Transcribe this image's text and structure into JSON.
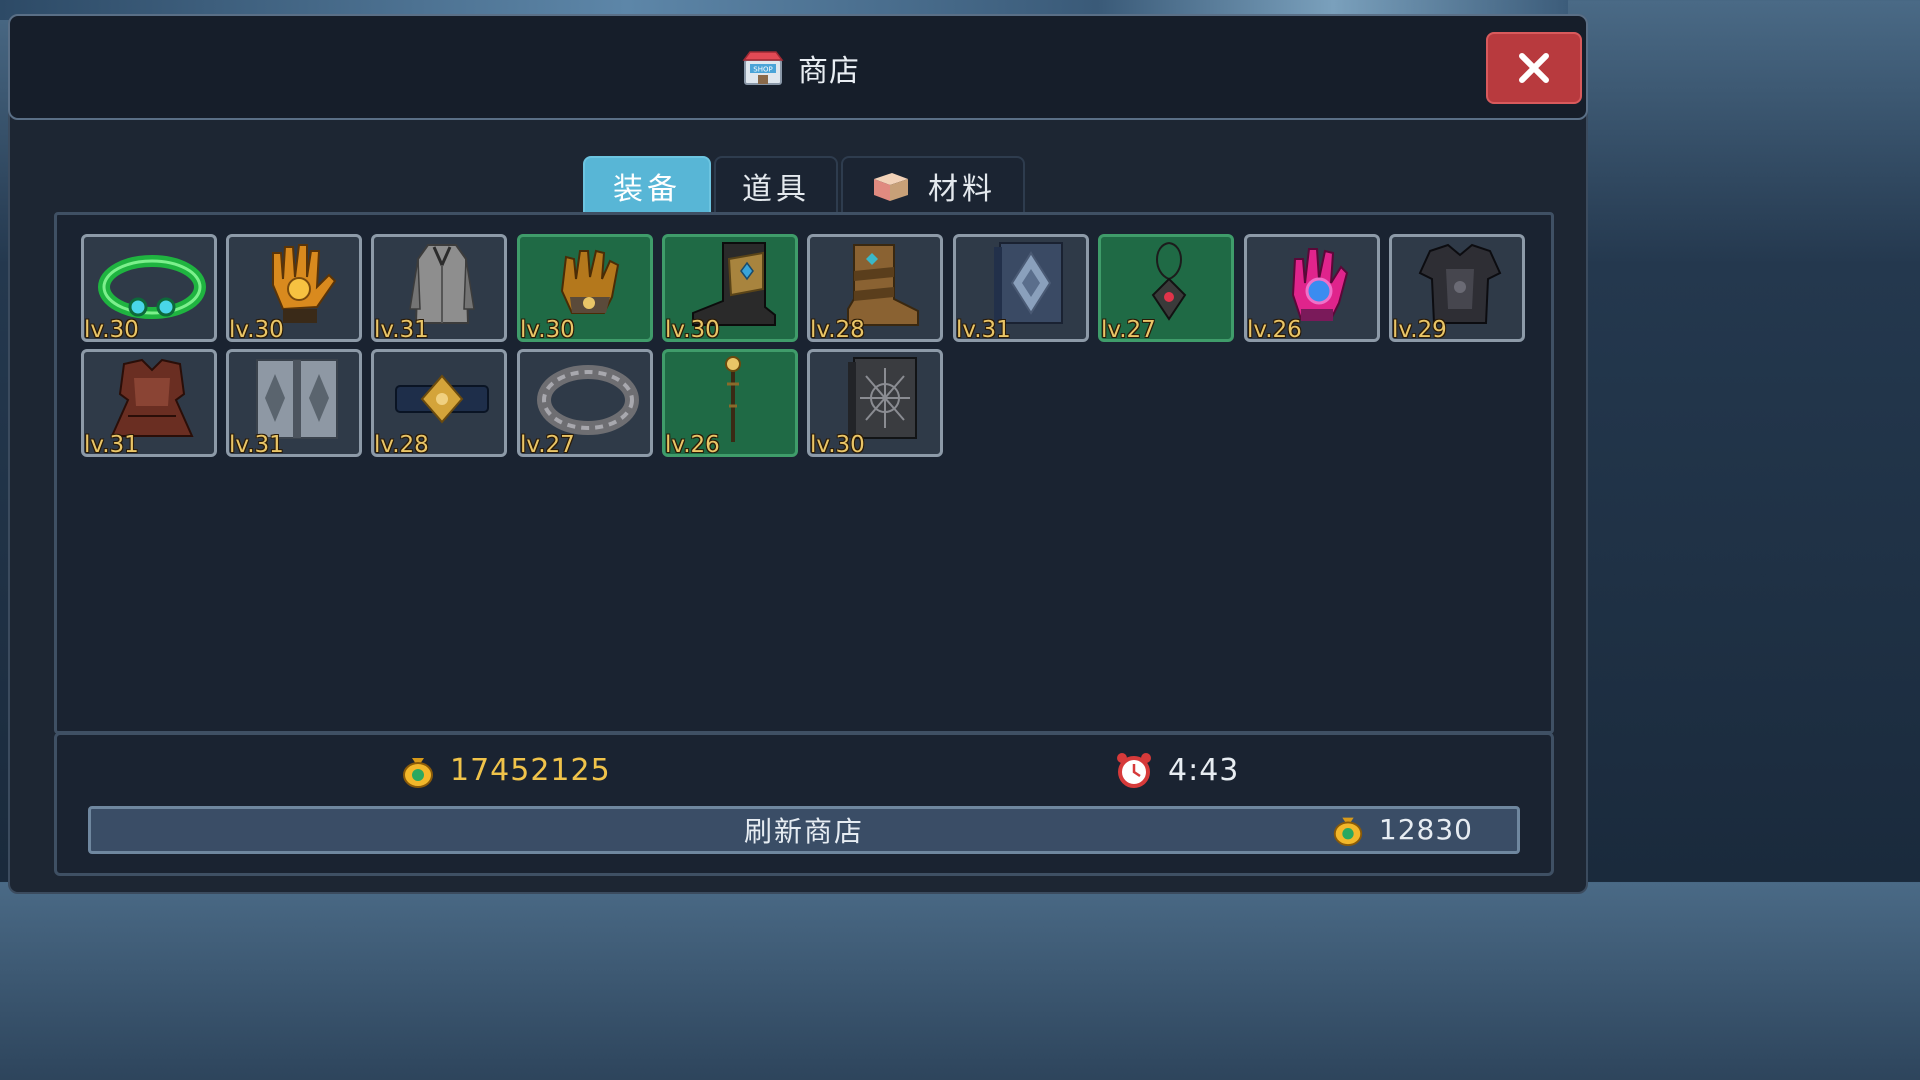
{
  "title": "商店",
  "tabs": [
    {
      "label": "装备",
      "active": true
    },
    {
      "label": "道具",
      "active": false
    },
    {
      "label": "材料",
      "active": false,
      "icon": "box-icon"
    }
  ],
  "items": [
    {
      "level": "lv.30",
      "icon": "ring-icon",
      "rarity": "normal"
    },
    {
      "level": "lv.30",
      "icon": "gauntlet-icon",
      "rarity": "normal"
    },
    {
      "level": "lv.31",
      "icon": "robe-icon",
      "rarity": "normal"
    },
    {
      "level": "lv.30",
      "icon": "gauntlet-icon",
      "rarity": "rare"
    },
    {
      "level": "lv.30",
      "icon": "boot-icon",
      "rarity": "rare"
    },
    {
      "level": "lv.28",
      "icon": "boot-icon",
      "rarity": "normal"
    },
    {
      "level": "lv.31",
      "icon": "tome-icon",
      "rarity": "normal"
    },
    {
      "level": "lv.27",
      "icon": "amulet-icon",
      "rarity": "rare"
    },
    {
      "level": "lv.26",
      "icon": "gauntlet-icon",
      "rarity": "normal"
    },
    {
      "level": "lv.29",
      "icon": "chest-armor-icon",
      "rarity": "normal"
    },
    {
      "level": "lv.31",
      "icon": "leather-armor-icon",
      "rarity": "normal"
    },
    {
      "level": "lv.31",
      "icon": "tome-icon",
      "rarity": "normal"
    },
    {
      "level": "lv.28",
      "icon": "belt-icon",
      "rarity": "normal"
    },
    {
      "level": "lv.27",
      "icon": "ring-icon",
      "rarity": "normal"
    },
    {
      "level": "lv.26",
      "icon": "staff-icon",
      "rarity": "rare"
    },
    {
      "level": "lv.30",
      "icon": "tome-icon",
      "rarity": "normal"
    }
  ],
  "gold": "17452125",
  "timer": "4:43",
  "refresh": {
    "label": "刷新商店",
    "cost": "12830"
  },
  "colors": {
    "accent_tab": "#58b6d6",
    "rare_slot": "#1f6a45",
    "gold_text": "#f0c34a",
    "close_button": "#b83a3e"
  }
}
